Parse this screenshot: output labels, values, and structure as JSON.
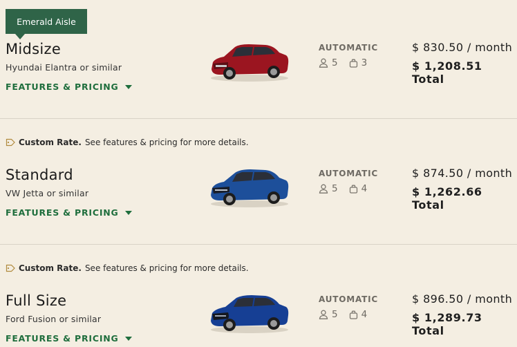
{
  "cards": [
    {
      "badge": "Emerald Aisle",
      "class_name": "Midsize",
      "vehicle": "Hyundai Elantra or similar",
      "features_link": "FEATURES & PRICING",
      "transmission": "AUTOMATIC",
      "passengers": "5",
      "bags": "3",
      "price_month": "$ 830.50 / month",
      "price_total": "$ 1,208.51 Total",
      "car_color": "#9b1520",
      "car_image": "red-sedan-image"
    },
    {
      "rate_label": "Custom Rate.",
      "rate_text": "See features & pricing for more details.",
      "class_name": "Standard",
      "vehicle": "VW Jetta or similar",
      "features_link": "FEATURES & PRICING",
      "transmission": "AUTOMATIC",
      "passengers": "5",
      "bags": "4",
      "price_month": "$ 874.50 / month",
      "price_total": "$ 1,262.66 Total",
      "car_color": "#1d4f9a",
      "car_image": "blue-sedan-image"
    },
    {
      "rate_label": "Custom Rate.",
      "rate_text": "See features & pricing for more details.",
      "class_name": "Full Size",
      "vehicle": "Ford Fusion or similar",
      "features_link": "FEATURES & PRICING",
      "transmission": "AUTOMATIC",
      "passengers": "5",
      "bags": "4",
      "price_month": "$ 896.50 / month",
      "price_total": "$ 1,289.73 Total",
      "car_color": "#163f94",
      "car_image": "blue-sedan-image"
    }
  ]
}
